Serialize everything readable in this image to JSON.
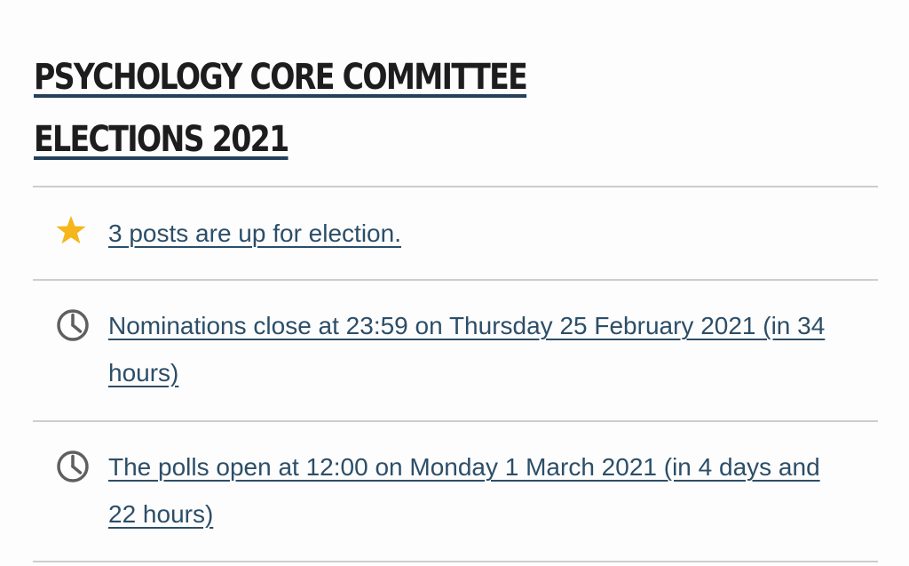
{
  "election": {
    "title": "PSYCHOLOGY CORE COMMITTEE ELECTIONS 2021"
  },
  "items": [
    {
      "icon": "star-icon",
      "text": "3 posts are up for election."
    },
    {
      "icon": "clock-icon",
      "text": "Nominations close at 23:59 on Thursday 25 February 2021 (in 34 hours)"
    },
    {
      "icon": "clock-icon",
      "text": "The polls open at 12:00 on Monday 1 March 2021 (in 4 days and 22 hours)"
    }
  ],
  "colors": {
    "link": "#2c4e68",
    "title_underline": "#23405c",
    "star": "#f5b61b",
    "divider": "#cdcdcd"
  }
}
